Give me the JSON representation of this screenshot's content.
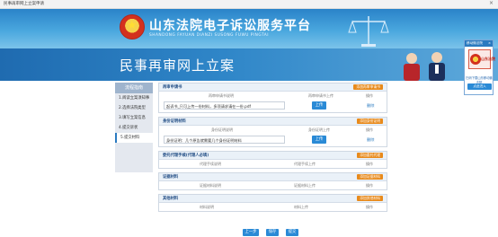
{
  "window": {
    "title": "民事再审网上立案申请",
    "close_glyph": "×"
  },
  "header": {
    "site_title": "山东法院电子诉讼服务平台",
    "site_subtitle": "SHANDONG FAYUAN DIANZI SUSONG FUWU PINGTAI"
  },
  "hero": {
    "title": "民事再审网上立案"
  },
  "sidebar": {
    "heading": "流程指南",
    "items": [
      {
        "label": "1.阅读立案须知事"
      },
      {
        "label": "2.选择法院类型"
      },
      {
        "label": "3.填写立案信息"
      },
      {
        "label": "4.提交诉状"
      },
      {
        "label": "5.提交材料"
      }
    ],
    "active_index": 4
  },
  "sections": {
    "petition": {
      "title": "再审申请书",
      "add_label": "添加再审申请书",
      "cols": [
        "再审申请书说明",
        "再审申请书上传",
        "操作"
      ],
      "field_value": "起诉书_只可上传一份材料，多项请求请在一份.pdf",
      "upload_label": "上传",
      "delete_label": "删除"
    },
    "identity": {
      "title": "身份证明材料",
      "add_label": "添加身份证明",
      "cols": [
        "身份证明说明",
        "身份证明上传",
        "操作"
      ],
      "field_value": "身份证明：几个原告就需要几个身份证明材料",
      "upload_label": "上传",
      "delete_label": "删除"
    },
    "agent": {
      "title": "委托代理手续(代理人必填)",
      "add_label": "添加委托代理",
      "cols": [
        "代理手续说明",
        "代理手续上传",
        "操作"
      ]
    },
    "evidence": {
      "title": "证据材料",
      "add_label": "添加证据材料",
      "cols": [
        "证据材料说明",
        "证据材料上传",
        "操作"
      ]
    },
    "other": {
      "title": "其他材料",
      "add_label": "添加其他材料",
      "cols": [
        "材料说明",
        "材料上传",
        "操作"
      ]
    }
  },
  "footer_buttons": {
    "prev": "上一步",
    "save": "保存",
    "submit": "提交"
  },
  "float_box": {
    "title": "移动微法院",
    "close_glyph": "×",
    "logo_text": "山东法院",
    "caption": "扫码下载山东移动微法院",
    "button": "点此进入"
  },
  "colors": {
    "header_blue": "#2a83c9",
    "accent_orange": "#e88a1b",
    "button_blue": "#2a8ad6"
  }
}
